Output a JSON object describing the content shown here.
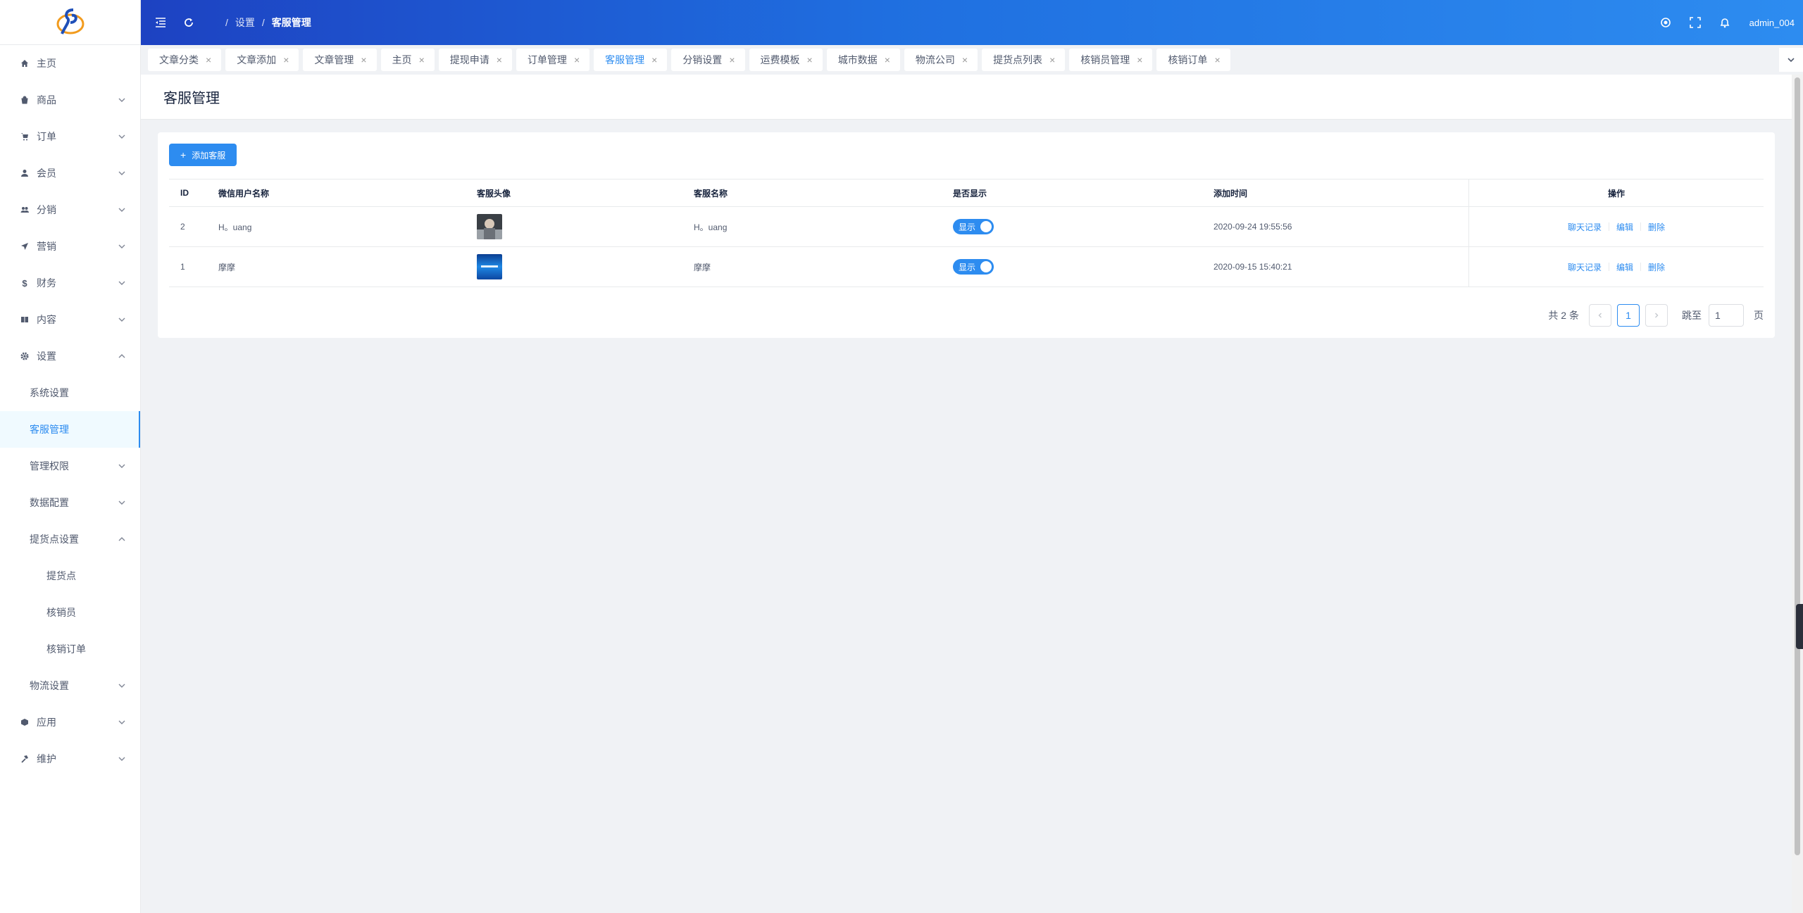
{
  "sidebar": {
    "menu": [
      {
        "label": "主页"
      },
      {
        "label": "商品"
      },
      {
        "label": "订单"
      },
      {
        "label": "会员"
      },
      {
        "label": "分销"
      },
      {
        "label": "营销"
      },
      {
        "label": "财务"
      },
      {
        "label": "内容"
      },
      {
        "label": "设置"
      }
    ],
    "settings_sub": [
      {
        "label": "系统设置"
      },
      {
        "label": "客服管理"
      },
      {
        "label": "管理权限"
      },
      {
        "label": "数据配置"
      },
      {
        "label": "提货点设置"
      }
    ],
    "pickup_sub": [
      {
        "label": "提货点"
      },
      {
        "label": "核销员"
      },
      {
        "label": "核销订单"
      }
    ],
    "logistics": "物流设置",
    "tail_menu": [
      {
        "label": "应用"
      },
      {
        "label": "维护"
      }
    ]
  },
  "header": {
    "breadcrumb": [
      "设置",
      "客服管理"
    ],
    "user": "admin_004"
  },
  "tabs": [
    {
      "label": "文章分类"
    },
    {
      "label": "文章添加"
    },
    {
      "label": "文章管理"
    },
    {
      "label": "主页"
    },
    {
      "label": "提现申请"
    },
    {
      "label": "订单管理"
    },
    {
      "label": "客服管理"
    },
    {
      "label": "分销设置"
    },
    {
      "label": "运费模板"
    },
    {
      "label": "城市数据"
    },
    {
      "label": "物流公司"
    },
    {
      "label": "提货点列表"
    },
    {
      "label": "核销员管理"
    },
    {
      "label": "核销订单"
    }
  ],
  "page": {
    "title": "客服管理",
    "add_button": "添加客服"
  },
  "table": {
    "columns": [
      "ID",
      "微信用户名称",
      "客服头像",
      "客服名称",
      "是否显示",
      "添加时间",
      "操作"
    ],
    "rows": [
      {
        "id": "2",
        "wx_name": "H。uang",
        "name": "H。uang",
        "show": "显示",
        "time": "2020-09-24 19:55:56"
      },
      {
        "id": "1",
        "wx_name": "摩摩",
        "name": "摩摩",
        "show": "显示",
        "time": "2020-09-15 15:40:21"
      }
    ],
    "ops": [
      "聊天记录",
      "编辑",
      "删除"
    ]
  },
  "pager": {
    "total": "共 2 条",
    "current": "1",
    "jump_label": "跳至",
    "jump_value": "1",
    "page_suffix": "页"
  },
  "colors": {
    "primary": "#2d8cf0",
    "header_start": "#1d42c2"
  }
}
